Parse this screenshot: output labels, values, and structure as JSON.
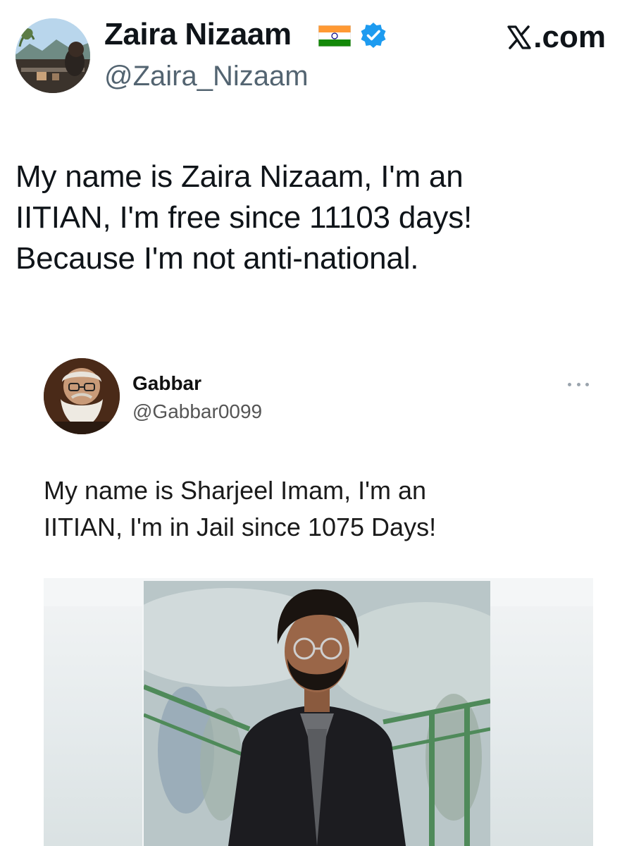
{
  "tweet": {
    "author": {
      "display_name": "Zaira Nizaam",
      "handle": "@Zaira_Nizaam",
      "flag": "india-flag-icon",
      "verified": true,
      "verified_color": "#1d9bf0"
    },
    "brand": ".com",
    "brand_icon": "x-logo-icon",
    "text_lines": [
      "My name is Zaira Nizaam, I'm an",
      "IITIAN, I'm free since 11103 days!",
      "Because I'm not anti-national."
    ]
  },
  "quoted_tweet": {
    "author": {
      "display_name": "Gabbar",
      "handle": "@Gabbar0099"
    },
    "more_icon": "ellipsis-icon",
    "text_lines": [
      "My name is Sharjeel Imam, I'm an",
      "IITIAN, I'm in Jail since 1075 Days!"
    ],
    "media": "photo-of-man-in-black-coat"
  },
  "colors": {
    "text_primary": "#0f1419",
    "text_secondary": "#536471",
    "verified_blue": "#1d9bf0"
  }
}
